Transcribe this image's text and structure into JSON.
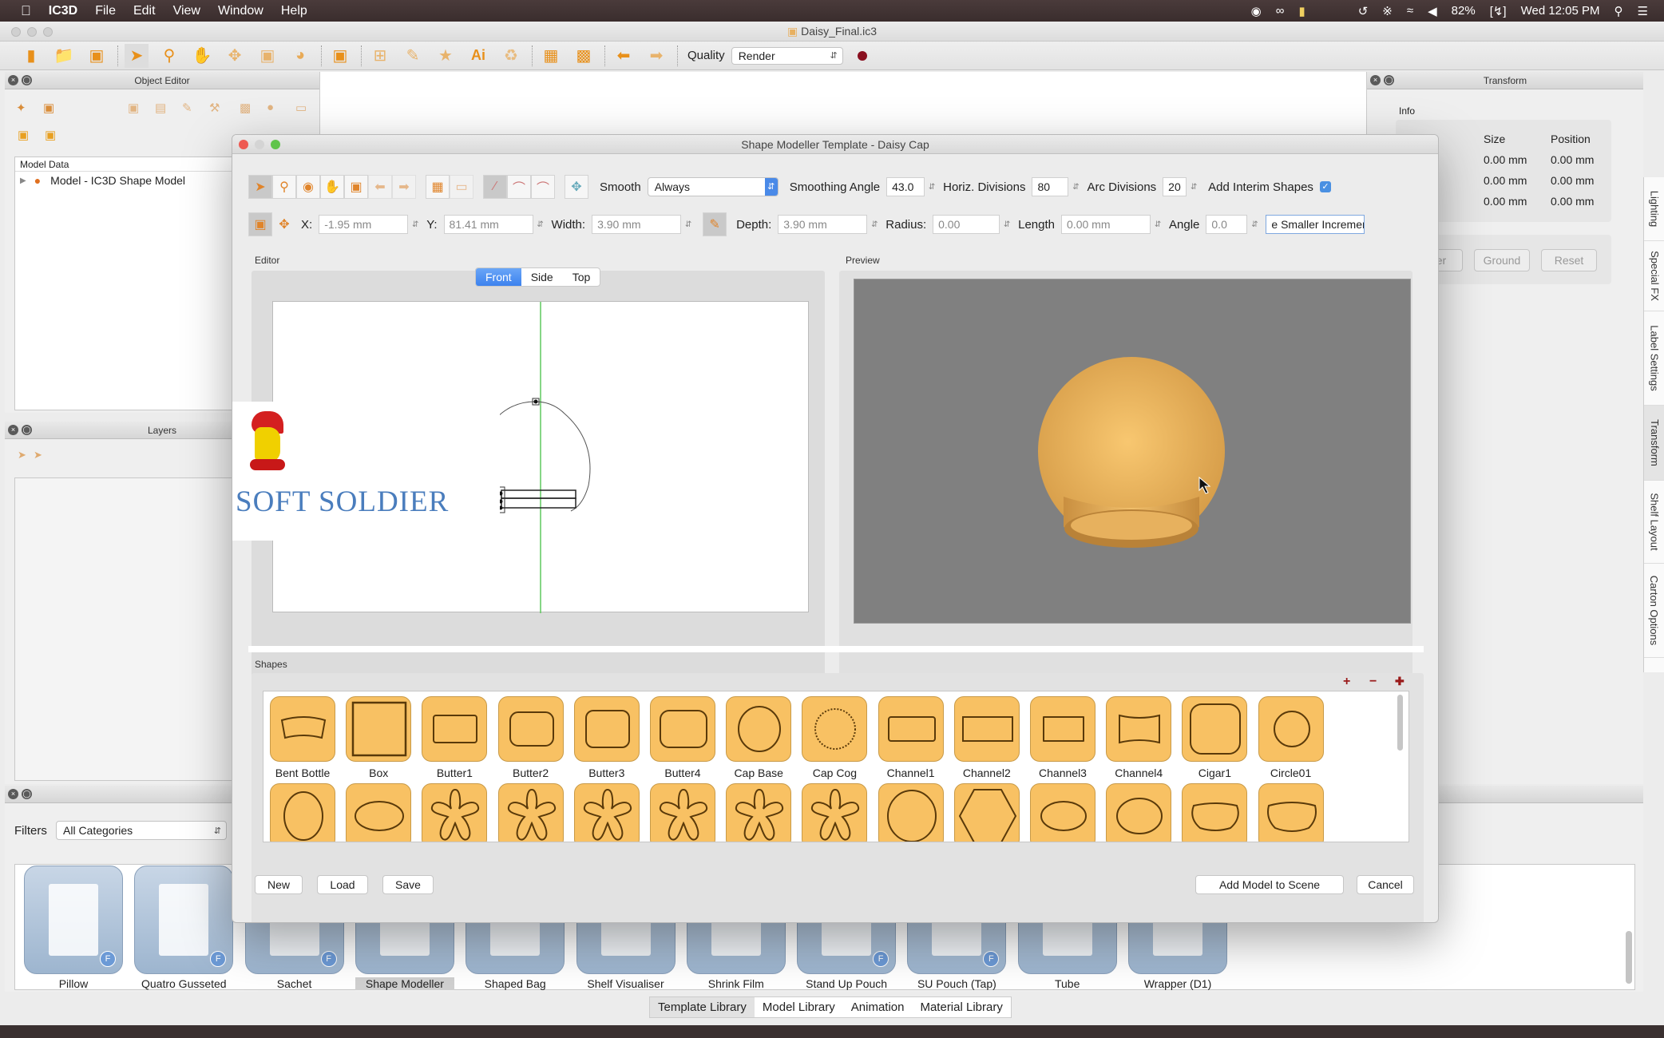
{
  "menubar": {
    "app_name": "IC3D",
    "items": [
      "File",
      "Edit",
      "View",
      "Window",
      "Help"
    ],
    "status": {
      "battery": "82%",
      "clock": "Wed 12:05 PM"
    }
  },
  "window": {
    "title": "Daisy_Final.ic3"
  },
  "toolbar": {
    "quality_label": "Quality",
    "quality_value": "Render"
  },
  "object_editor": {
    "title": "Object Editor",
    "model_data_header": "Model Data",
    "tree_items": [
      {
        "label": "Model - IC3D Shape Model"
      }
    ]
  },
  "layers": {
    "title": "Layers"
  },
  "transform": {
    "title": "Transform",
    "info_label": "Info",
    "columns": [
      "Size",
      "Position"
    ],
    "rows": [
      {
        "size": "0.00 mm",
        "position": "0.00 mm"
      },
      {
        "size": "0.00 mm",
        "position": "0.00 mm"
      },
      {
        "size": "0.00 mm",
        "position": "0.00 mm"
      }
    ],
    "buttons": {
      "center_partial": "er",
      "ground": "Ground",
      "reset": "Reset"
    }
  },
  "side_tabs": [
    "Lighting",
    "Special FX",
    "Label Settings",
    "Transform",
    "Shelf Layout",
    "Carton Options"
  ],
  "side_tabs_active": "Transform",
  "library": {
    "filters_label": "Filters",
    "filter_value": "All Categories",
    "items": [
      {
        "name": "Pillow",
        "f": true
      },
      {
        "name": "Quatro Gusseted",
        "f": true
      },
      {
        "name": "Sachet",
        "f": true
      },
      {
        "name": "Shape Modeller",
        "f": false
      },
      {
        "name": "Shaped Bag",
        "f": false
      },
      {
        "name": "Shelf Visualiser",
        "f": false
      },
      {
        "name": "Shrink Film",
        "f": false
      },
      {
        "name": "Stand Up Pouch",
        "f": true
      },
      {
        "name": "SU Pouch (Tap)",
        "f": true
      },
      {
        "name": "Tube",
        "f": false
      },
      {
        "name": "Wrapper (D1)",
        "f": false
      }
    ],
    "selected": "Shape Modeller",
    "f_badge": "F",
    "tabs": [
      "Template Library",
      "Model Library",
      "Animation",
      "Material Library"
    ],
    "active_tab": "Template Library"
  },
  "dialog": {
    "title": "Shape Modeller Template - Daisy Cap",
    "smooth_label": "Smooth",
    "smooth_value": "Always",
    "smoothing_angle_label": "Smoothing Angle",
    "smoothing_angle": "43.0",
    "horiz_div_label": "Horiz. Divisions",
    "horiz_div": "80",
    "arc_div_label": "Arc Divisions",
    "arc_div": "20",
    "interim_label": "Add Interim Shapes",
    "interim_checked": true,
    "x_label": "X:",
    "x": "-1.95 mm",
    "y_label": "Y:",
    "y": "81.41 mm",
    "width_label": "Width:",
    "width": "3.90 mm",
    "depth_label": "Depth:",
    "depth": "3.90 mm",
    "radius_label": "Radius:",
    "radius": "0.00",
    "length_label": "Length",
    "length": "0.00 mm",
    "angle_label": "Angle",
    "angle": "0.0",
    "increment_button": "e Smaller Incremer",
    "editor_label": "Editor",
    "preview_label": "Preview",
    "view_tabs": [
      "Front",
      "Side",
      "Top"
    ],
    "active_view": "Front",
    "shapes_label": "Shapes",
    "shapes_row1": [
      "Bent Bottle",
      "Box",
      "Butter1",
      "Butter2",
      "Butter3",
      "Butter4",
      "Cap Base",
      "Cap Cog",
      "Channel1",
      "Channel2",
      "Channel3",
      "Channel4",
      "Cigar1",
      "Circle01"
    ],
    "buttons": {
      "new": "New",
      "load": "Load",
      "save": "Save",
      "add": "Add Model to Scene",
      "cancel": "Cancel"
    }
  },
  "watermark": {
    "text": "SOFT SOLDIER"
  },
  "colors": {
    "accent_orange": "#f8c163",
    "selection_blue": "#3d82ee",
    "preview_bg": "#808080"
  }
}
